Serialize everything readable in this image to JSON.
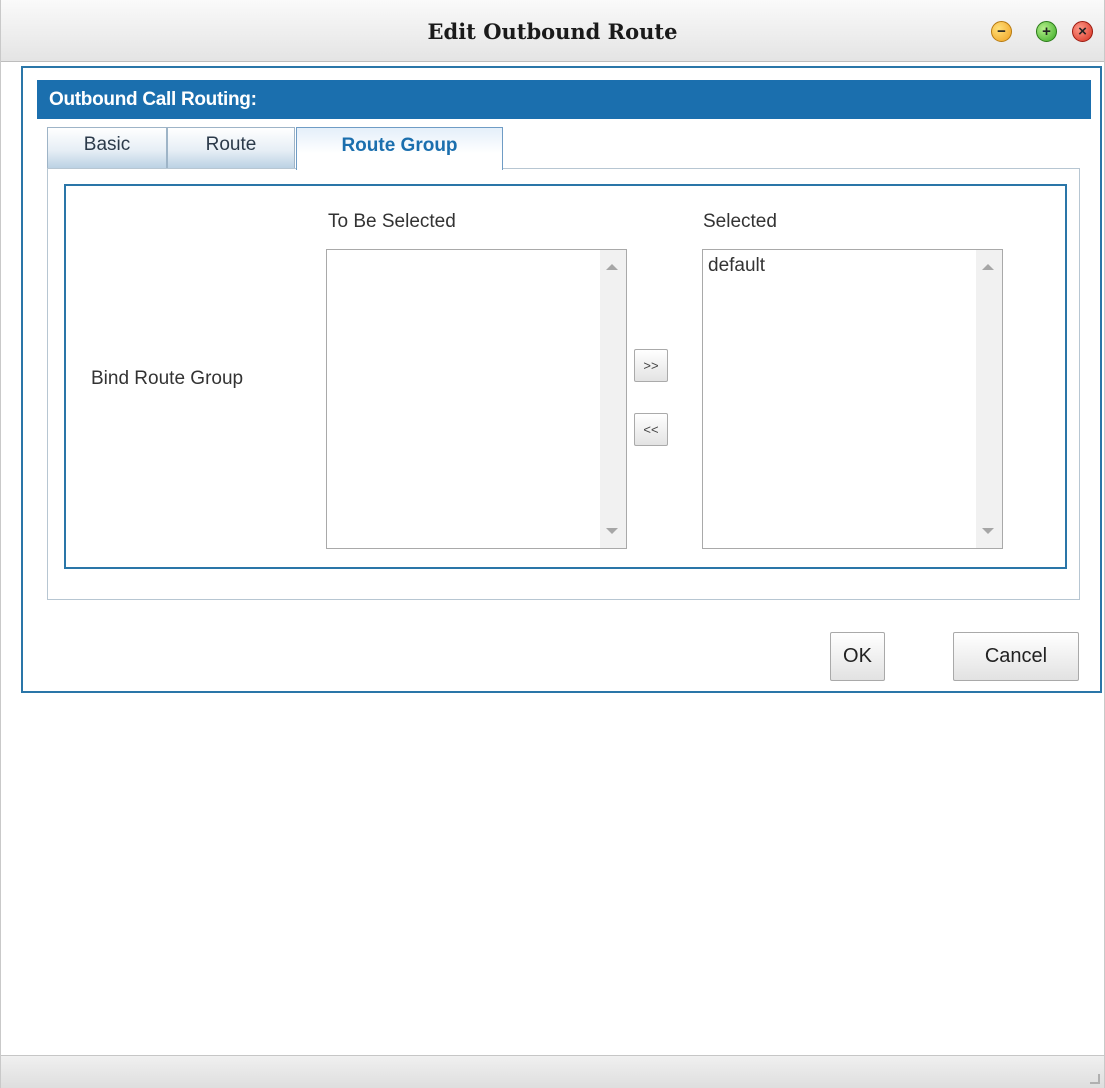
{
  "window": {
    "title": "Edit Outbound Route"
  },
  "header": {
    "section_title": "Outbound Call Routing:"
  },
  "tabs": [
    {
      "label": "Basic",
      "active": false
    },
    {
      "label": "Route",
      "active": false
    },
    {
      "label": "Route Group",
      "active": true
    }
  ],
  "form": {
    "bind_label": "Bind Route Group",
    "to_be_selected_label": "To Be Selected",
    "selected_label": "Selected",
    "to_be_selected_options": [],
    "selected_options": [
      "default"
    ],
    "move_right_label": ">>",
    "move_left_label": "<<"
  },
  "buttons": {
    "ok": "OK",
    "cancel": "Cancel"
  },
  "colors": {
    "accent": "#1b6fae",
    "border": "#2a76a8"
  }
}
